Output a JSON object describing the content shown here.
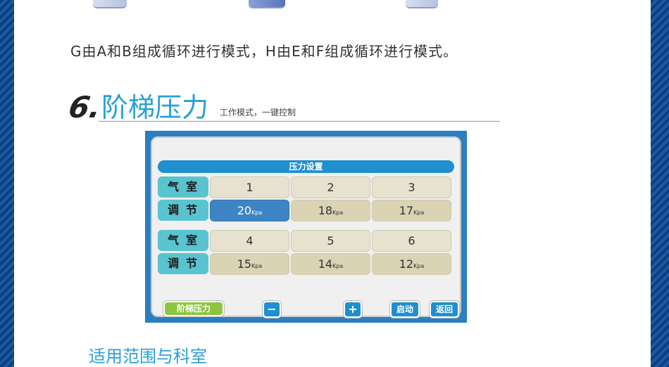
{
  "description": "G由A和B组成循环进行模式，H由E和F组成循环进行模式。",
  "section": {
    "number": "6.",
    "title": "阶梯压力",
    "subtitle": "工作模式，一键控制"
  },
  "panel": {
    "header": "压力设置",
    "chamber_label": "气室",
    "adjust_label": "调节",
    "groups": [
      {
        "chambers": [
          "1",
          "2",
          "3"
        ],
        "values": [
          "20",
          "18",
          "17"
        ]
      },
      {
        "chambers": [
          "4",
          "5",
          "6"
        ],
        "values": [
          "15",
          "14",
          "12"
        ]
      }
    ],
    "unit": "Kpa",
    "buttons": {
      "mode": "阶梯压力",
      "minus": "−",
      "plus": "+",
      "start": "启动",
      "back": "返回"
    },
    "colors": {
      "frame": "#2a7fc0",
      "header": "#1f8fd0",
      "label": "#5ac3d0",
      "active": "#3d84c4",
      "mode_button": "#8cc63f"
    }
  },
  "footer": {
    "title": "适用范围与科室"
  }
}
